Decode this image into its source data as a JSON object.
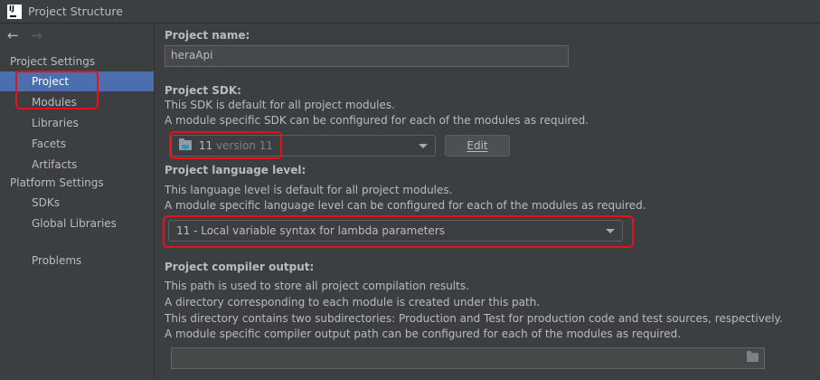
{
  "window": {
    "title": "Project Structure"
  },
  "nav": {
    "back": "←",
    "forward": "→"
  },
  "sidebar": {
    "project_settings_header": "Project Settings",
    "project_settings_items": [
      {
        "label": "Project",
        "selected": true
      },
      {
        "label": "Modules"
      },
      {
        "label": "Libraries"
      },
      {
        "label": "Facets"
      },
      {
        "label": "Artifacts"
      }
    ],
    "platform_settings_header": "Platform Settings",
    "platform_settings_items": [
      {
        "label": "SDKs"
      },
      {
        "label": "Global Libraries"
      }
    ],
    "problems_label": "Problems"
  },
  "project_name": {
    "label": "Project name:",
    "value": "heraApi"
  },
  "project_sdk": {
    "label": "Project SDK:",
    "desc1": "This SDK is default for all project modules.",
    "desc2": "A module specific SDK can be configured for each of the modules as required.",
    "selected_name": "11",
    "selected_version": "version 11",
    "edit_label": "Edit"
  },
  "language_level": {
    "label": "Project language level:",
    "desc1": "This language level is default for all project modules.",
    "desc2": "A module specific language level can be configured for each of the modules as required.",
    "selected": "11 - Local variable syntax for lambda parameters"
  },
  "compiler_output": {
    "label": "Project compiler output:",
    "desc1": "This path is used to store all project compilation results.",
    "desc2": "A directory corresponding to each module is created under this path.",
    "desc3": "This directory contains two subdirectories: Production and Test for production code and test sources, respectively.",
    "desc4": "A module specific compiler output path can be configured for each of the modules as required.",
    "value": ""
  },
  "colors": {
    "background": "#3c3f41",
    "selection": "#4b6eaf",
    "highlight_box": "#e8101a",
    "text": "#bbbbbb"
  }
}
